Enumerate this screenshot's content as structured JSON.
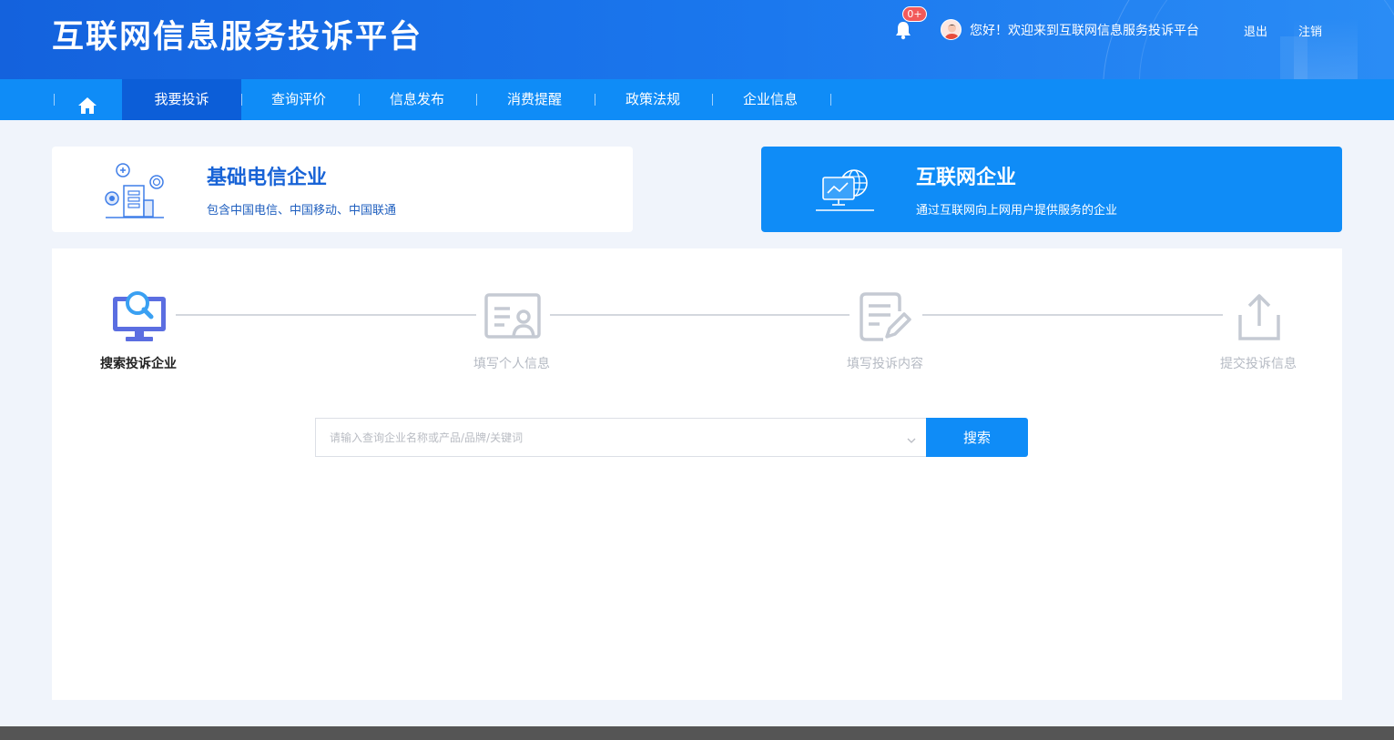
{
  "header": {
    "title": "互联网信息服务投诉平台",
    "notification_badge": "0+",
    "welcome": "您好！欢迎来到互联网信息服务投诉平台",
    "logout": "退出",
    "cancel_account": "注销"
  },
  "nav": {
    "items": [
      {
        "label": "我要投诉"
      },
      {
        "label": "查询评价"
      },
      {
        "label": "信息发布"
      },
      {
        "label": "消费提醒"
      },
      {
        "label": "政策法规"
      },
      {
        "label": "企业信息"
      }
    ]
  },
  "categories": {
    "telecom": {
      "title": "基础电信企业",
      "desc": "包含中国电信、中国移动、中国联通"
    },
    "internet": {
      "title": "互联网企业",
      "desc": "通过互联网向上网用户提供服务的企业"
    }
  },
  "steps": [
    {
      "label": "搜索投诉企业",
      "state": "active",
      "icon": "monitor-search-icon"
    },
    {
      "label": "填写个人信息",
      "state": "inactive",
      "icon": "id-card-icon"
    },
    {
      "label": "填写投诉内容",
      "state": "inactive",
      "icon": "edit-document-icon"
    },
    {
      "label": "提交投诉信息",
      "state": "inactive",
      "icon": "upload-icon"
    }
  ],
  "search": {
    "placeholder": "请输入查询企业名称或产品/品牌/关键词",
    "button": "搜索"
  },
  "colors": {
    "primary": "#0f8cf7",
    "nav_active": "#0c5ed8",
    "header_start": "#1462dd",
    "step_active": "#5b6ee1",
    "step_inactive": "#c5cad3"
  }
}
